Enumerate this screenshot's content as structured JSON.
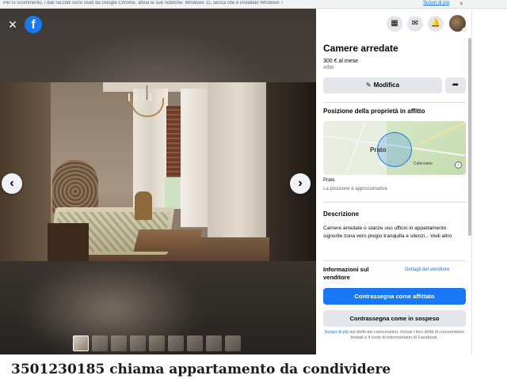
{
  "infobar": {
    "text": "Per lo scorrimento, i dati raccolti sono usati da Google Chrome, attiva le sue notifiche: Windows 11, senza che è installato Windows 7",
    "link": "Scopri di più",
    "close": "×"
  },
  "viewer": {
    "close_glyph": "✕",
    "logo_letter": "f",
    "prev_glyph": "‹",
    "next_glyph": "›",
    "thumbnail_count": 9,
    "active_thumbnail": 0
  },
  "topbar": {
    "menu_glyph": "▦",
    "messenger_glyph": "✉",
    "notifications_glyph": "🔔"
  },
  "listing": {
    "title": "Camere arredate",
    "price": "300 € al mese",
    "price_sub": "Affitti",
    "edit_label": "Modifica",
    "share_glyph": "➦"
  },
  "location": {
    "section_title": "Posizione della proprietà in affitto",
    "map_city": "Prato",
    "map_town": "Calenzano",
    "map_info": "i",
    "place": "Prato",
    "note": "La posizione è approssimativa"
  },
  "description": {
    "section_title": "Descrizione",
    "text": "Camere arredate o stanze uso ufficio in appartamento signorile zona vero pregio tranquilla e silenzi... Vedi altro"
  },
  "seller": {
    "title": "Informazioni sul venditore",
    "details_link": "Dettagli del venditore"
  },
  "actions": {
    "mark_rented": "Contrassegna come affittato",
    "mark_pending": "Contrassegna come in sospeso"
  },
  "disclaimer": {
    "link": "Scopri di più",
    "text": "sui diritti dei consumatori, inclusi i loro diritti di consumatore limitati e il ruolo di intermediario di Facebook."
  },
  "page": {
    "bottom_title": "3501230185 chiama appartamento da condividere"
  },
  "colors": {
    "primary": "#1877f2",
    "secondary_bg": "#e4e6eb",
    "text": "#050505",
    "muted": "#65676b"
  }
}
